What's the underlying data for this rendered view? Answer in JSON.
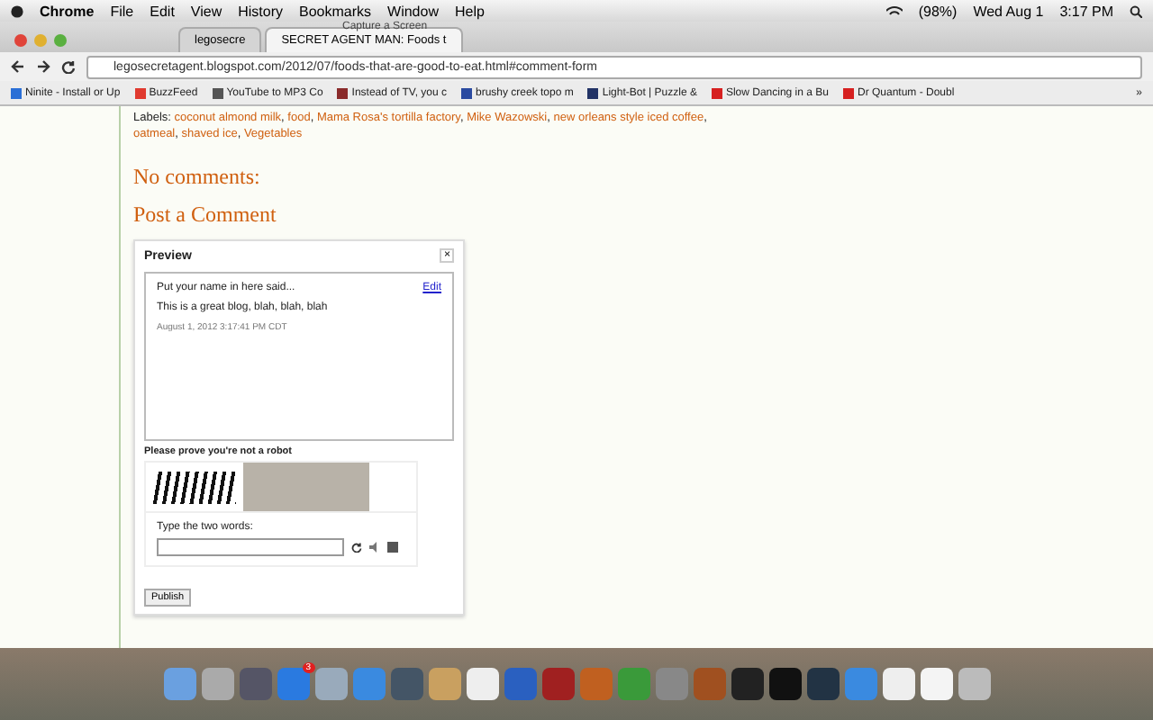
{
  "menu_bar": {
    "app": "Chrome",
    "items": [
      "File",
      "Edit",
      "View",
      "History",
      "Bookmarks",
      "Window",
      "Help"
    ],
    "battery": "(98%)",
    "date": "Wed Aug 1",
    "time": "3:17 PM"
  },
  "behind_window_title": "Capture a Screen",
  "tabs": [
    {
      "label": "legosecre",
      "selected": false
    },
    {
      "label": "SECRET AGENT MAN: Foods t",
      "selected": true
    }
  ],
  "address": "legosecretagent.blogspot.com/2012/07/foods-that-are-good-to-eat.html#comment-form",
  "bookmarks": [
    {
      "label": "Ninite - Install or Up",
      "color": "#2a6fd6"
    },
    {
      "label": "BuzzFeed",
      "color": "#e03a2f"
    },
    {
      "label": "YouTube to MP3 Co",
      "color": "#555555"
    },
    {
      "label": "Instead of TV, you c",
      "color": "#8a2a2a"
    },
    {
      "label": "brushy creek topo m",
      "color": "#2a4aa0"
    },
    {
      "label": "Light-Bot | Puzzle &",
      "color": "#223366"
    },
    {
      "label": "Slow Dancing in a Bu",
      "color": "#d62020"
    },
    {
      "label": "Dr Quantum - Doubl",
      "color": "#d62020"
    }
  ],
  "bookmarks_more": "»",
  "labels": {
    "prefix": "Labels:",
    "separator": ",",
    "links": [
      "coconut almond milk",
      "food",
      "Mama Rosa's tortilla factory",
      "Mike Wazowski",
      "new orleans style iced coffee",
      "oatmeal",
      "shaved ice",
      "Vegetables"
    ]
  },
  "no_comments": "No comments:",
  "post_heading": "Post a Comment",
  "preview": {
    "title": "Preview",
    "close": "×",
    "author": "Put your name in here said...",
    "edit": "Edit",
    "body": "This is a great blog, blah, blah, blah",
    "timestamp": "August 1, 2012 3:17:41 PM CDT"
  },
  "captcha": {
    "prompt": "Please prove you're not a robot",
    "instruction": "Type the two words:"
  },
  "publish": "Publish",
  "dock": {
    "app_store_badge": "3"
  }
}
